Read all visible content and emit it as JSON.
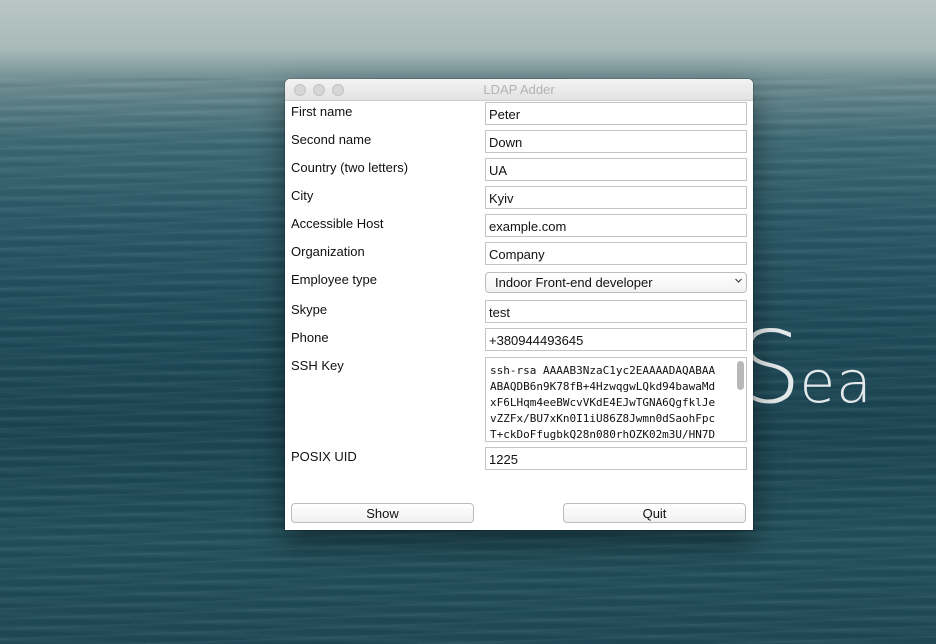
{
  "wallpaper": {
    "word_main": "S",
    "word_rest": "ea"
  },
  "window": {
    "title": "LDAP Adder"
  },
  "form": {
    "first_name": {
      "label": "First name",
      "value": "Peter"
    },
    "second_name": {
      "label": "Second name",
      "value": "Down"
    },
    "country": {
      "label": "Country (two letters)",
      "value": "UA"
    },
    "city": {
      "label": "City",
      "value": "Kyiv"
    },
    "host": {
      "label": "Accessible Host",
      "value": "example.com"
    },
    "organization": {
      "label": "Organization",
      "value": "Company"
    },
    "employee_type": {
      "label": "Employee type",
      "value": "Indoor Front-end developer"
    },
    "skype": {
      "label": "Skype",
      "value": "test"
    },
    "phone": {
      "label": "Phone",
      "value": "+380944493645"
    },
    "ssh_key": {
      "label": "SSH Key",
      "value": "ssh-rsa AAAAB3NzaC1yc2EAAAADAQABAA\nABAQDB6n9K78fB+4HzwqgwLQkd94bawaMd\nxF6LHqm4eeBWcvVKdE4EJwTGNA6QgfklJe\nvZZFx/BU7xKn0I1iU86Z8Jwmn0dSaohFpc\nT+ckDoFfugbkQ28n080rhOZK02m3U/HN7D"
    },
    "posix_uid": {
      "label": "POSIX UID",
      "value": "1225"
    }
  },
  "buttons": {
    "show_label": "Show",
    "quit_label": "Quit"
  }
}
